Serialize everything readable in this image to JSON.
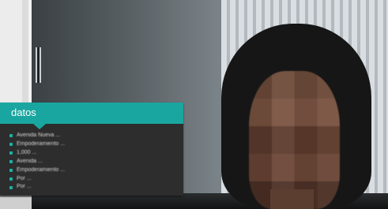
{
  "slide": {
    "title": "datos",
    "bullets": [
      "Avenida Nueva ...",
      "Empoderamiento ...",
      "1,000 ...",
      "Avenida ...",
      "Empoderamiento ...",
      "Por ...",
      "Por ..."
    ]
  },
  "colors": {
    "accent": "#1aa6a0",
    "bullet": "#19b5a7",
    "card_bg": "#2d2d2d"
  },
  "icons": {
    "slider": "slider-handle"
  }
}
